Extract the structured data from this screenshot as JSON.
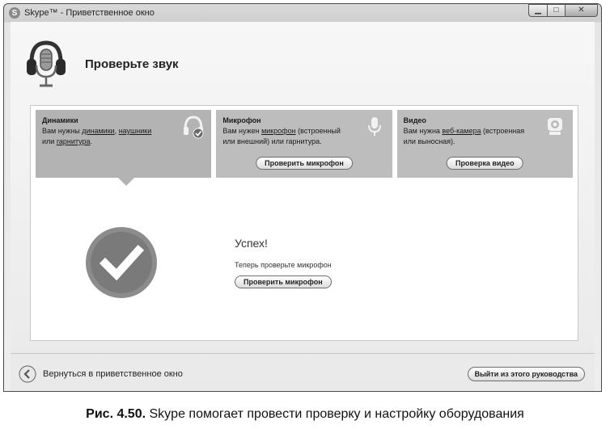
{
  "window": {
    "title": "Skype™ - Приветственное окно",
    "app_glyph": "S"
  },
  "header": {
    "title": "Проверьте звук",
    "icon": "headset-microphone-icon"
  },
  "cards": [
    {
      "title": "Динамики",
      "desc_parts": [
        "Вам нужны ",
        "динамики",
        ", ",
        "наушники",
        " или ",
        "гарнитура",
        "."
      ],
      "icon": "headphones-check-icon"
    },
    {
      "title": "Микрофон",
      "desc_parts": [
        "Вам нужен ",
        "микрофон",
        " (встроенный или внешний) или гарнитура."
      ],
      "button": "Проверить микрофон",
      "icon": "microphone-icon"
    },
    {
      "title": "Видео",
      "desc_parts": [
        "Вам нужна ",
        "веб-камера",
        " (встроенная или выносная)."
      ],
      "button": "Проверка видео",
      "icon": "webcam-icon"
    }
  ],
  "result": {
    "title": "Успех!",
    "message": "Теперь проверьте микрофон",
    "button": "Проверить микрофон"
  },
  "footer": {
    "back_label": "Вернуться в приветственное окно",
    "exit_label": "Выйти из этого руководства"
  },
  "caption": {
    "label": "Рис. 4.50.",
    "text": " Skype помогает провести проверку и настройку оборудования"
  }
}
